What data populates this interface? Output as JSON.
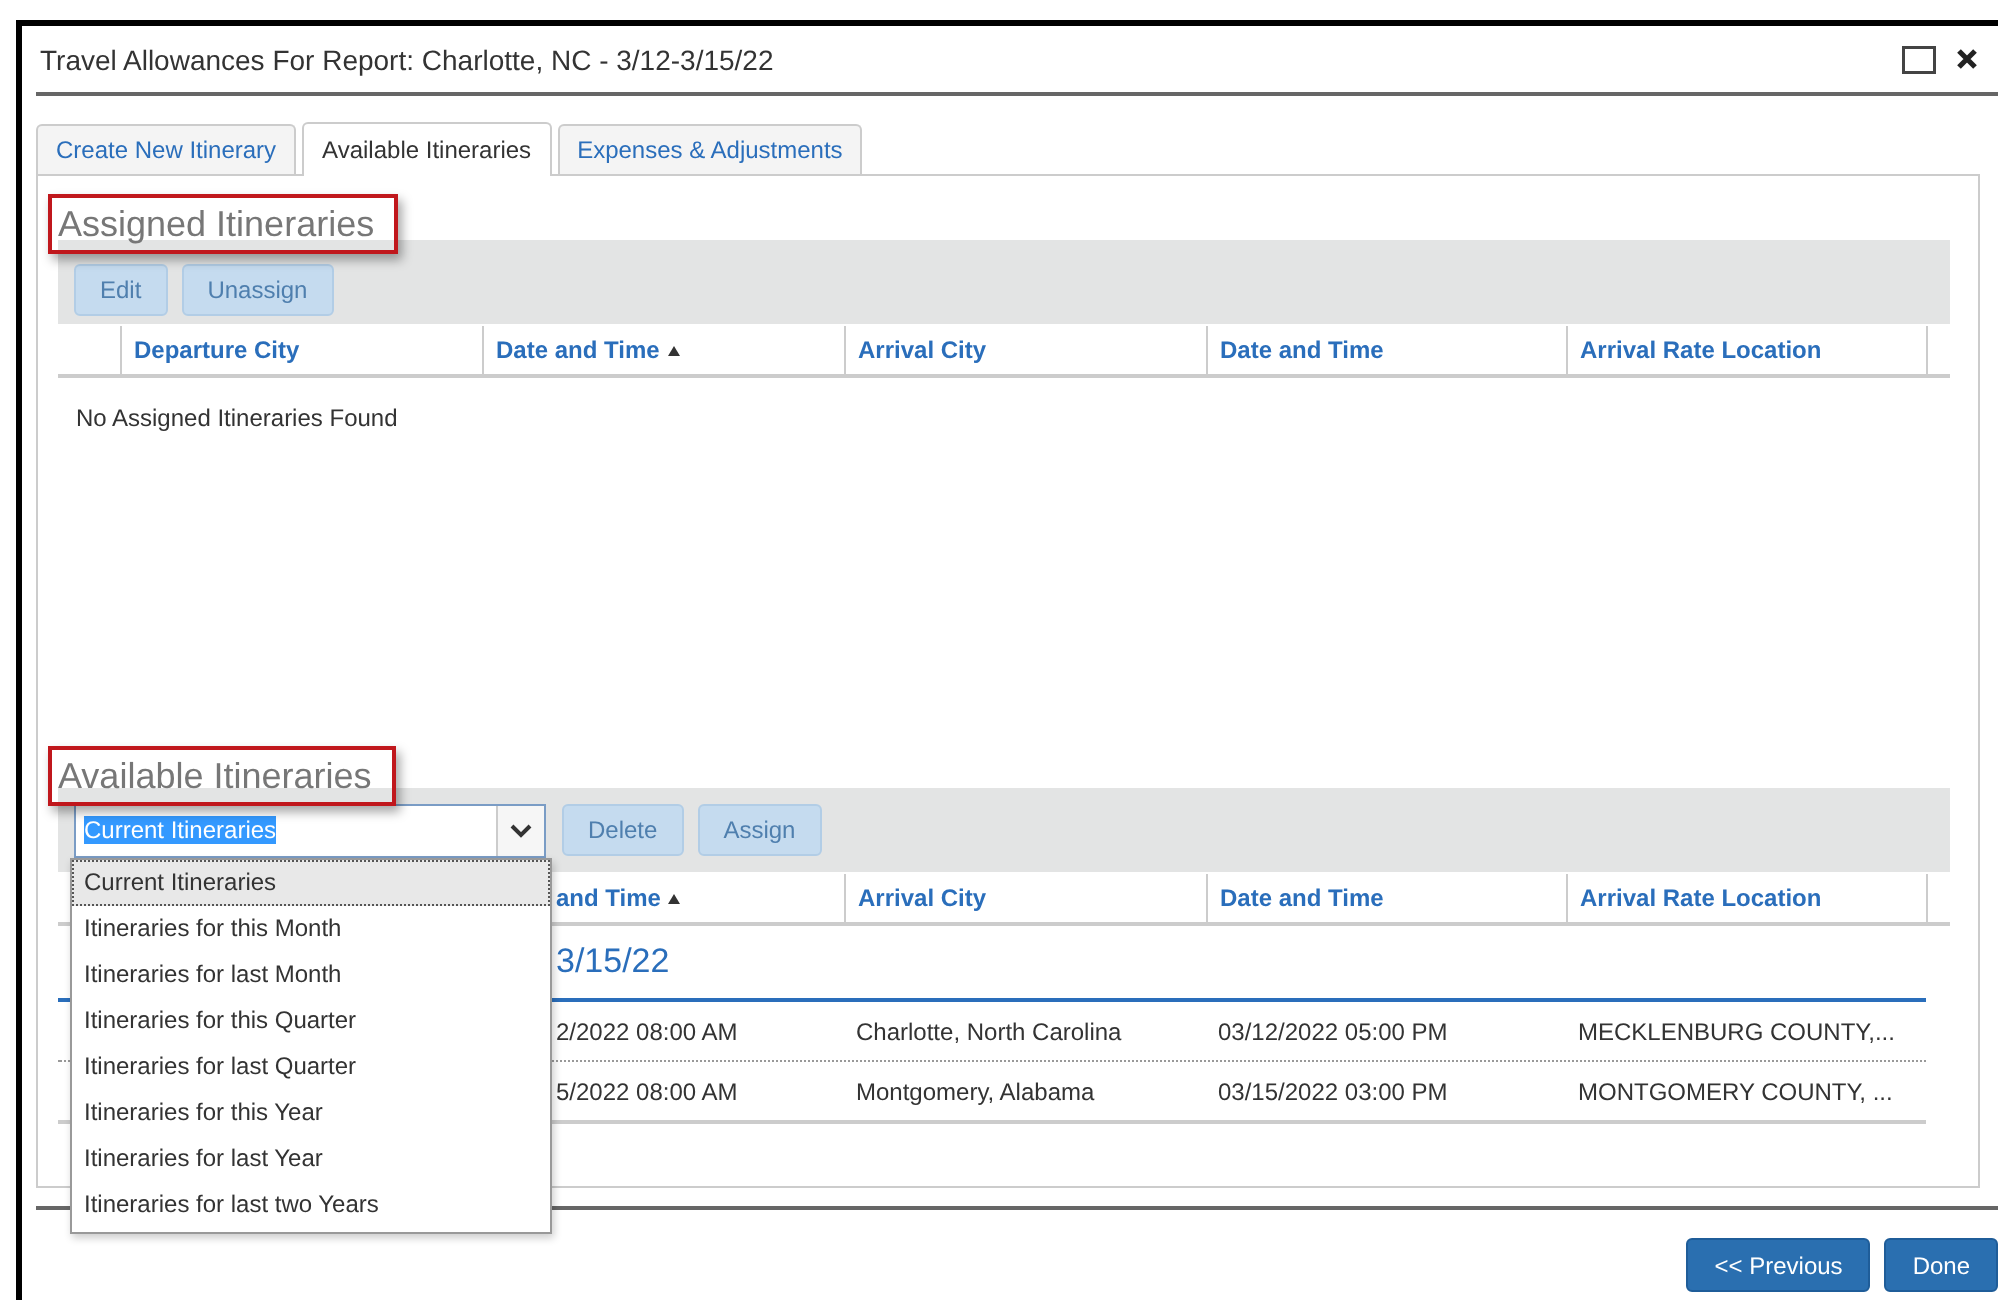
{
  "window": {
    "title": "Travel Allowances For Report: Charlotte, NC - 3/12-3/15/22"
  },
  "tabs": [
    {
      "label": "Create New Itinerary",
      "selected": false
    },
    {
      "label": "Available Itineraries",
      "selected": true
    },
    {
      "label": "Expenses & Adjustments",
      "selected": false
    }
  ],
  "assigned": {
    "heading": "Assigned Itineraries",
    "annotated": true,
    "buttons": [
      {
        "label": "Edit",
        "disabled": true
      },
      {
        "label": "Unassign",
        "disabled": true
      }
    ],
    "columns": [
      {
        "label": "Departure City",
        "sorted": false
      },
      {
        "label": "Date and Time",
        "sorted": true
      },
      {
        "label": "Arrival City",
        "sorted": false
      },
      {
        "label": "Date and Time",
        "sorted": false
      },
      {
        "label": "Arrival Rate Location",
        "sorted": false
      }
    ],
    "empty_message": "No Assigned Itineraries Found"
  },
  "available": {
    "heading": "Available Itineraries",
    "annotated": true,
    "filter": {
      "value": "Current Itineraries",
      "expanded": true,
      "options": [
        {
          "label": "Current Itineraries",
          "selected": true
        },
        {
          "label": "Itineraries for this Month",
          "selected": false
        },
        {
          "label": "Itineraries for last Month",
          "selected": false
        },
        {
          "label": "Itineraries for this Quarter",
          "selected": false
        },
        {
          "label": "Itineraries for last Quarter",
          "selected": false
        },
        {
          "label": "Itineraries for this Year",
          "selected": false
        },
        {
          "label": "Itineraries for last Year",
          "selected": false
        },
        {
          "label": "Itineraries for last two Years",
          "selected": false
        }
      ]
    },
    "buttons": [
      {
        "label": "Delete",
        "disabled": true
      },
      {
        "label": "Assign",
        "disabled": true
      }
    ],
    "columns": [
      {
        "label": "and Time",
        "sorted": true
      },
      {
        "label": "Arrival City",
        "sorted": false
      },
      {
        "label": "Date and Time",
        "sorted": false
      },
      {
        "label": "Arrival Rate Location",
        "sorted": false
      }
    ],
    "group_label": "3/15/22",
    "rows": [
      {
        "cells": [
          "2/2022 08:00 AM",
          "Charlotte, North Carolina",
          "03/12/2022 05:00 PM",
          "MECKLENBURG COUNTY,..."
        ]
      },
      {
        "cells": [
          "5/2022 08:00 AM",
          "Montgomery, Alabama",
          "03/15/2022 03:00 PM",
          "MONTGOMERY COUNTY, ..."
        ]
      }
    ]
  },
  "footer_buttons": [
    {
      "label": "<< Previous"
    },
    {
      "label": "Done"
    }
  ]
}
